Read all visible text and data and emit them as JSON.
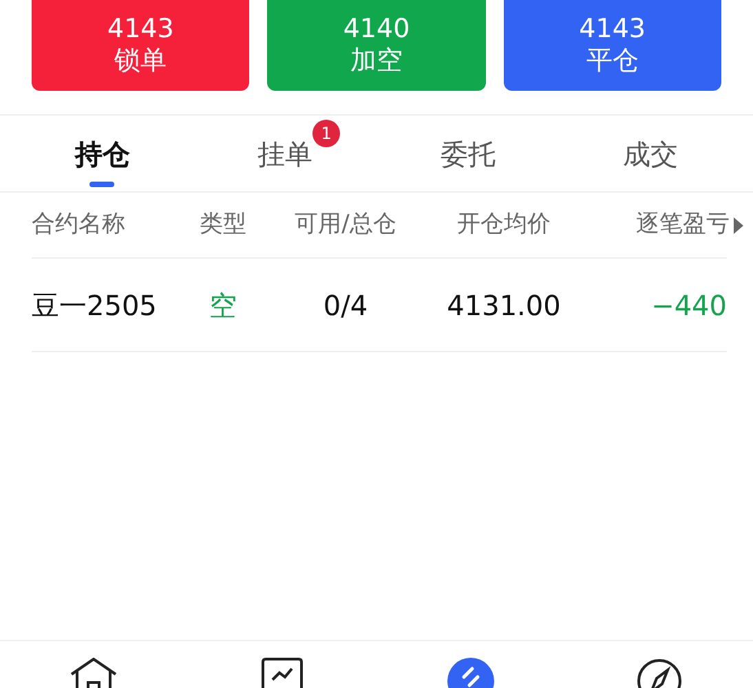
{
  "order_buttons": [
    {
      "price": "4143",
      "label": "锁单",
      "kind": "lock"
    },
    {
      "price": "4140",
      "label": "加空",
      "kind": "short"
    },
    {
      "price": "4143",
      "label": "平仓",
      "kind": "close"
    }
  ],
  "tabs": [
    {
      "label": "持仓",
      "selected": true
    },
    {
      "label": "挂单",
      "selected": false,
      "badge": "1"
    },
    {
      "label": "委托",
      "selected": false
    },
    {
      "label": "成交",
      "selected": false
    }
  ],
  "table": {
    "columns": [
      "合约名称",
      "类型",
      "可用/总仓",
      "开仓均价",
      "逐笔盈亏"
    ],
    "more_columns": true,
    "rows": [
      {
        "contract": "豆一2505",
        "type": "空",
        "kind": "short",
        "available": "0/4",
        "avg_price": "4131.00",
        "pnl": "−440"
      }
    ]
  },
  "bottom_nav": [
    {
      "kind": "home",
      "selected": false
    },
    {
      "kind": "chart",
      "selected": false
    },
    {
      "kind": "trade",
      "selected": true
    },
    {
      "kind": "compass",
      "selected": false
    }
  ]
}
